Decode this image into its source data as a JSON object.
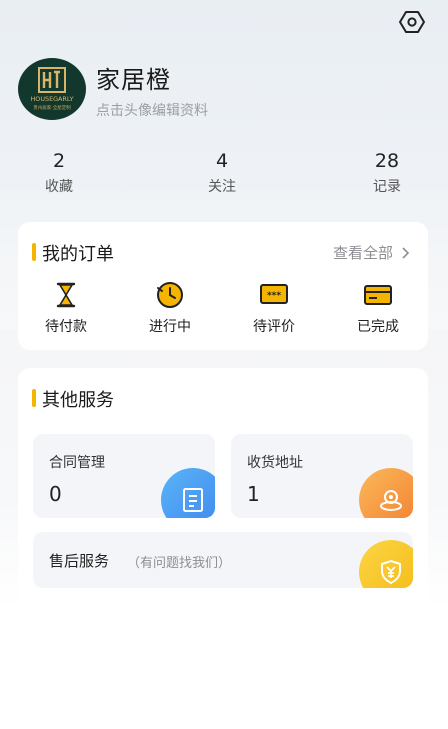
{
  "profile": {
    "name": "家居橙",
    "subtitle": "点击头像编辑资料",
    "logo_text": "HOUSEGARLY",
    "logo_subtext": "贵州居家·全屋定制"
  },
  "stats": [
    {
      "count": "2",
      "label": "收藏"
    },
    {
      "count": "4",
      "label": "关注"
    },
    {
      "count": "28",
      "label": "记录"
    }
  ],
  "orders": {
    "title": "我的订单",
    "view_all": "查看全部",
    "items": [
      {
        "label": "待付款",
        "icon": "hourglass-icon"
      },
      {
        "label": "进行中",
        "icon": "clock-icon"
      },
      {
        "label": "待评价",
        "icon": "review-icon"
      },
      {
        "label": "已完成",
        "icon": "completed-card-icon"
      }
    ]
  },
  "services": {
    "title": "其他服务",
    "contract": {
      "label": "合同管理",
      "value": "0",
      "icon": "document-icon"
    },
    "address": {
      "label": "收货地址",
      "value": "1",
      "icon": "location-icon"
    },
    "after_sale": {
      "label": "售后服务",
      "hint": "（有问题找我们）",
      "icon": "yuan-shield-icon"
    }
  },
  "colors": {
    "accent": "#f4b400",
    "blue_badge": "#4d9bf5",
    "orange_badge": "#f79a3c",
    "yellow_badge": "#f7c51f"
  }
}
